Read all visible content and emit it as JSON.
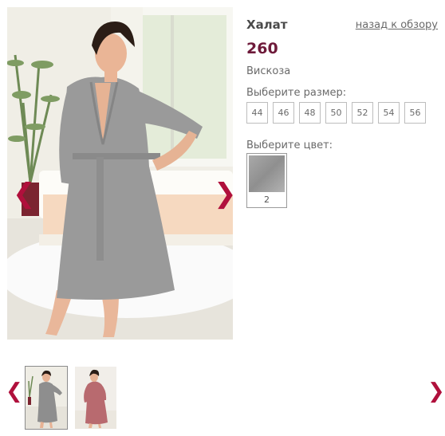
{
  "product": {
    "title": "Халат",
    "price": "260",
    "material": "Вискоза",
    "back_link": "назад к обзору"
  },
  "sizes": {
    "label": "Выберите размер:",
    "options": [
      "44",
      "46",
      "48",
      "50",
      "52",
      "54",
      "56"
    ]
  },
  "colors": {
    "label": "Выберите цвет:",
    "options": [
      {
        "number": "2",
        "swatch": "#9c9c9c"
      }
    ]
  },
  "gallery": {
    "prev_icon": "chevron-left-icon",
    "next_icon": "chevron-right-icon",
    "arrow_color": "#b0103c",
    "thumbnails": [
      {
        "label": "grey-robe",
        "color": "#8e8e8e",
        "selected": true
      },
      {
        "label": "pink-robe",
        "color": "#b86a6f",
        "selected": false
      }
    ]
  },
  "colors_theme": {
    "price": "#6e1a3a",
    "accent": "#b0103c",
    "text": "#6a6a6a"
  }
}
